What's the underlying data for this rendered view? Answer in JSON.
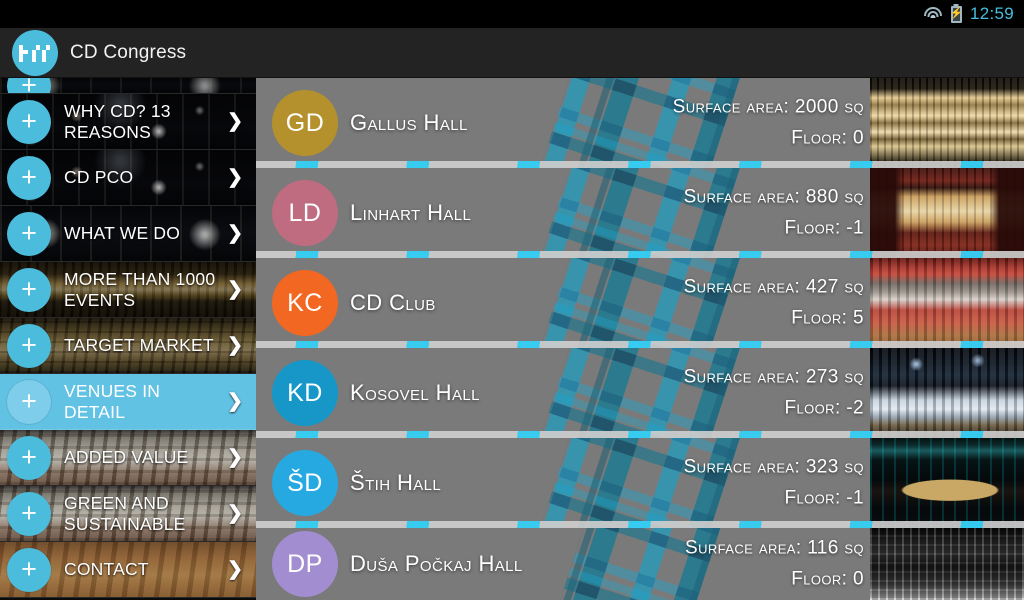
{
  "statusbar": {
    "time": "12:59",
    "battery_glyph": "⚡",
    "icons": [
      "wifi-icon",
      "battery-charging-icon"
    ]
  },
  "actionbar": {
    "app_title": "CD Congress",
    "logo_text": "hdd"
  },
  "sidebar": {
    "items": [
      {
        "label": "",
        "plus": "+",
        "chevron": "❯",
        "bg": "bg-darkHall",
        "dim": "dim-strong",
        "height": 16,
        "partial": true,
        "selected": false
      },
      {
        "label": "WHY CD? 13 REASONS",
        "plus": "+",
        "chevron": "❯",
        "bg": "bg-stageLights",
        "dim": "dim-mid",
        "height": 56,
        "selected": false
      },
      {
        "label": "CD PCO",
        "plus": "+",
        "chevron": "❯",
        "bg": "bg-stageLights",
        "dim": "dim-mid",
        "height": 56,
        "selected": false
      },
      {
        "label": "WHAT WE DO",
        "plus": "+",
        "chevron": "❯",
        "bg": "bg-darkHall",
        "dim": "dim-mid",
        "height": 56,
        "selected": false
      },
      {
        "label": "MORE THAN 1000 EVENTS",
        "plus": "+",
        "chevron": "❯",
        "bg": "bg-balcony",
        "dim": "dim-strong",
        "height": 56,
        "selected": false
      },
      {
        "label": "TARGET MARKET",
        "plus": "+",
        "chevron": "❯",
        "bg": "bg-seatsGold",
        "dim": "dim-strong",
        "height": 56,
        "selected": false
      },
      {
        "label": "VENUES IN DETAIL",
        "plus": "+",
        "chevron": "❯",
        "bg": "",
        "dim": "dim-none",
        "height": 56,
        "selected": true
      },
      {
        "label": "ADDED VALUE",
        "plus": "+",
        "chevron": "❯",
        "bg": "bg-seatsGrey",
        "dim": "dim-soft",
        "height": 56,
        "selected": false
      },
      {
        "label": "GREEN AND SUSTAINABLE",
        "plus": "+",
        "chevron": "❯",
        "bg": "bg-seatsGrey",
        "dim": "dim-soft",
        "height": 56,
        "selected": false
      },
      {
        "label": "CONTACT",
        "plus": "+",
        "chevron": "❯",
        "bg": "bg-wood",
        "dim": "dim-soft",
        "height": 56,
        "selected": false
      }
    ]
  },
  "list": {
    "rows": [
      {
        "initials": "GD",
        "name": "Gallus Hall",
        "surface": "Surface area: 2000 sq",
        "floor": "Floor: 0",
        "color": "#b4912d",
        "thumb": "th-goldAud",
        "height": 90
      },
      {
        "initials": "LD",
        "name": "Linhart Hall",
        "surface": "Surface area: 880 sq",
        "floor": "Floor: -1",
        "color": "#bf6c81",
        "thumb": "th-redTheatre",
        "height": 90
      },
      {
        "initials": "KC",
        "name": "CD Club",
        "surface": "Surface area: 427 sq",
        "floor": "Floor: 5",
        "color": "#f26722",
        "thumb": "th-redHall",
        "height": 90
      },
      {
        "initials": "KD",
        "name": "Kosovel Hall",
        "surface": "Surface area: 273 sq",
        "floor": "Floor: -2",
        "color": "#1797c8",
        "thumb": "th-blueSeats",
        "height": 90
      },
      {
        "initials": "ŠD",
        "name": "Štih Hall",
        "surface": "Surface area: 323 sq",
        "floor": "Floor: -1",
        "color": "#26a9e0",
        "thumb": "th-roundStage",
        "height": 90
      },
      {
        "initials": "DP",
        "name": "Duša Počkaj Hall",
        "surface": "Surface area: 116 sq",
        "floor": "Floor: 0",
        "color": "#a18dd0",
        "thumb": "th-bwRig",
        "height": 72
      }
    ]
  },
  "theme": {
    "accent": "#4cbcdc",
    "selected_row": "#62c2e4",
    "pattern_base": "#7b7b7b",
    "pattern_teal": "#127a96",
    "pattern_cyan": "#1aa8d0",
    "clock_color": "#44bfe0",
    "actionbar_bg": "#232323"
  }
}
